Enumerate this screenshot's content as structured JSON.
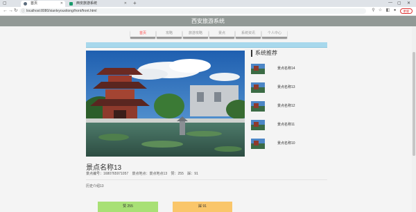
{
  "browser": {
    "tabs": [
      {
        "label": "首页"
      },
      {
        "label": "西安旅游系统"
      }
    ],
    "url": "localhost:8080/xianlvyouxitong/front/front.html",
    "update_label": "更新"
  },
  "site": {
    "title": "西安旅游系统",
    "nav": [
      "首页",
      "攻略",
      "旅游攻略",
      "景点",
      "系统资讯",
      "个人中心"
    ]
  },
  "sidebar": {
    "title": "系统推荐",
    "items": [
      {
        "label": "景点名称14"
      },
      {
        "label": "景点名称13"
      },
      {
        "label": "景点名称12"
      },
      {
        "label": "景点名称11"
      },
      {
        "label": "景点名称10"
      }
    ]
  },
  "detail": {
    "title": "景点名称13",
    "meta": {
      "code": "景点编号：1680765971057",
      "location": "景点地点：景点地点13",
      "likes": "赞：255",
      "dislikes": "踩：91"
    },
    "intro": "历史介绍13"
  },
  "actions": {
    "like_label": "赞 255",
    "dislike_label": "踩 91"
  },
  "colors": {
    "header": "#929996",
    "nav_active": "#ff4d4d",
    "like": "#a8e075",
    "dislike": "#fac66a",
    "banner": "#a8d8ec"
  }
}
